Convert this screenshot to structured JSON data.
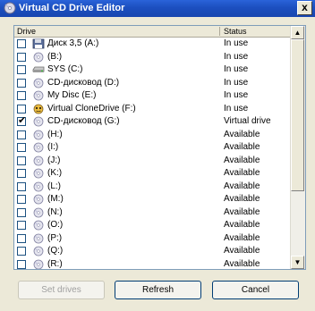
{
  "window": {
    "title": "Virtual CD Drive Editor",
    "close_glyph": "x"
  },
  "listview": {
    "columns": {
      "drive": "Drive",
      "status": "Status"
    },
    "rows": [
      {
        "name": "Диск 3,5 (A:)",
        "status": "In use",
        "checked": false,
        "icon": "floppy-icon"
      },
      {
        "name": "(B:)",
        "status": "In use",
        "checked": false,
        "icon": "cd-drive-icon"
      },
      {
        "name": "SYS (C:)",
        "status": "In use",
        "checked": false,
        "icon": "hard-disk-icon"
      },
      {
        "name": "CD-дисковод (D:)",
        "status": "In use",
        "checked": false,
        "icon": "cd-drive-icon"
      },
      {
        "name": "My Disc (E:)",
        "status": "In use",
        "checked": false,
        "icon": "cd-drive-icon"
      },
      {
        "name": "Virtual CloneDrive (F:)",
        "status": "In use",
        "checked": false,
        "icon": "clonedrive-icon"
      },
      {
        "name": "CD-дисковод (G:)",
        "status": "Virtual drive",
        "checked": true,
        "icon": "cd-drive-icon"
      },
      {
        "name": "(H:)",
        "status": "Available",
        "checked": false,
        "icon": "cd-drive-icon"
      },
      {
        "name": "(I:)",
        "status": "Available",
        "checked": false,
        "icon": "cd-drive-icon"
      },
      {
        "name": "(J:)",
        "status": "Available",
        "checked": false,
        "icon": "cd-drive-icon"
      },
      {
        "name": "(K:)",
        "status": "Available",
        "checked": false,
        "icon": "cd-drive-icon"
      },
      {
        "name": "(L:)",
        "status": "Available",
        "checked": false,
        "icon": "cd-drive-icon"
      },
      {
        "name": "(M:)",
        "status": "Available",
        "checked": false,
        "icon": "cd-drive-icon"
      },
      {
        "name": "(N:)",
        "status": "Available",
        "checked": false,
        "icon": "cd-drive-icon"
      },
      {
        "name": "(O:)",
        "status": "Available",
        "checked": false,
        "icon": "cd-drive-icon"
      },
      {
        "name": "(P:)",
        "status": "Available",
        "checked": false,
        "icon": "cd-drive-icon"
      },
      {
        "name": "(Q:)",
        "status": "Available",
        "checked": false,
        "icon": "cd-drive-icon"
      },
      {
        "name": "(R:)",
        "status": "Available",
        "checked": false,
        "icon": "cd-drive-icon"
      }
    ]
  },
  "buttons": {
    "set_drives": "Set drives",
    "refresh": "Refresh",
    "cancel": "Cancel"
  },
  "colors": {
    "titlebar": "#1c4fbf",
    "window_bg": "#ece9d8",
    "list_bg": "#ffffff"
  }
}
